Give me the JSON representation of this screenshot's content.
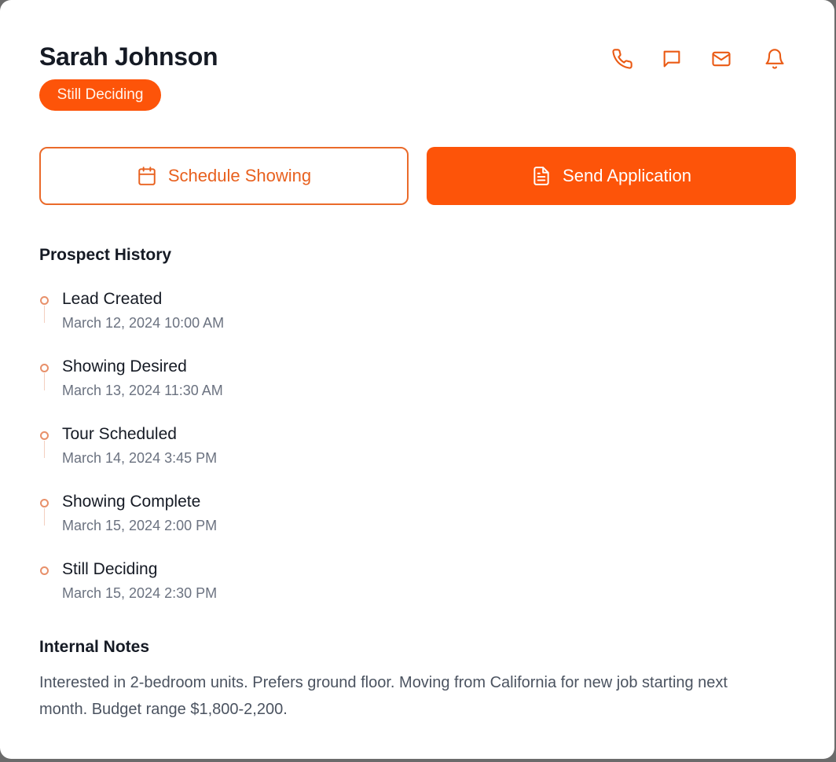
{
  "prospect": {
    "name": "Sarah Johnson",
    "status_badge": "Still Deciding"
  },
  "contact_actions": [
    {
      "icon": "phone-icon",
      "label": "Call"
    },
    {
      "icon": "message-icon",
      "label": "Message"
    },
    {
      "icon": "mail-icon",
      "label": "Email"
    },
    {
      "icon": "bell-icon",
      "label": "Notifications"
    }
  ],
  "actions": {
    "schedule_showing": "Schedule Showing",
    "send_application": "Send Application"
  },
  "history": {
    "title": "Prospect History",
    "items": [
      {
        "title": "Lead Created",
        "date": "March 12, 2024 10:00 AM"
      },
      {
        "title": "Showing Desired",
        "date": "March 13, 2024 11:30 AM"
      },
      {
        "title": "Tour Scheduled",
        "date": "March 14, 2024 3:45 PM"
      },
      {
        "title": "Showing Complete",
        "date": "March 15, 2024 2:00 PM"
      },
      {
        "title": "Still Deciding",
        "date": "March 15, 2024 2:30 PM"
      }
    ]
  },
  "notes": {
    "title": "Internal Notes",
    "text": "Interested in 2-bedroom units. Prefers ground floor. Moving from California for new job starting next month. Budget range $1,800-2,200."
  },
  "colors": {
    "accent": "#fd5409",
    "accent_text": "#e8611f",
    "heading": "#151a24",
    "muted": "#6b7280"
  }
}
